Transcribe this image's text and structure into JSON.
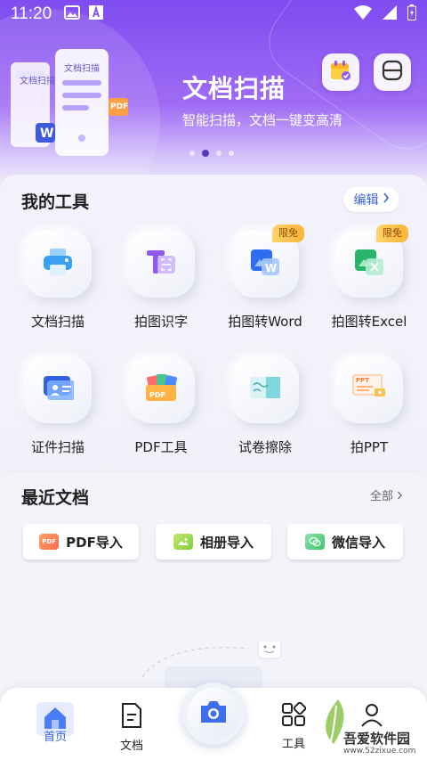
{
  "status": {
    "time": "11:20"
  },
  "hero": {
    "title": "文档扫描",
    "subtitle": "智能扫描，文档一键变高清",
    "illus_doc1": "文档扫描",
    "illus_doc2": "文档扫描",
    "pdf_tag": "PDF"
  },
  "tools": {
    "title": "我的工具",
    "edit_label": "编辑",
    "items": [
      {
        "label": "文档扫描",
        "icon": "printer-icon"
      },
      {
        "label": "拍图识字",
        "icon": "text-recognition-icon"
      },
      {
        "label": "拍图转Word",
        "icon": "word-convert-icon",
        "badge": "限免"
      },
      {
        "label": "拍图转Excel",
        "icon": "excel-convert-icon",
        "badge": "限免"
      },
      {
        "label": "证件扫描",
        "icon": "id-card-icon"
      },
      {
        "label": "PDF工具",
        "icon": "pdf-folder-icon"
      },
      {
        "label": "试卷擦除",
        "icon": "eraser-icon"
      },
      {
        "label": "拍PPT",
        "icon": "ppt-icon"
      }
    ]
  },
  "recent": {
    "title": "最近文档",
    "all_label": "全部",
    "imports": [
      {
        "label": "PDF导入",
        "icon": "pdf-icon"
      },
      {
        "label": "相册导入",
        "icon": "album-icon"
      },
      {
        "label": "微信导入",
        "icon": "wechat-icon"
      }
    ]
  },
  "nav": {
    "home": "首页",
    "docs": "文档",
    "tools": "工具"
  },
  "watermark": {
    "brand": "吾爱软件园",
    "url": "www.52zixue.com"
  },
  "colors": {
    "accent": "#3a63d8",
    "hero_start": "#7f4cf0",
    "badge": "#ffc24a"
  }
}
